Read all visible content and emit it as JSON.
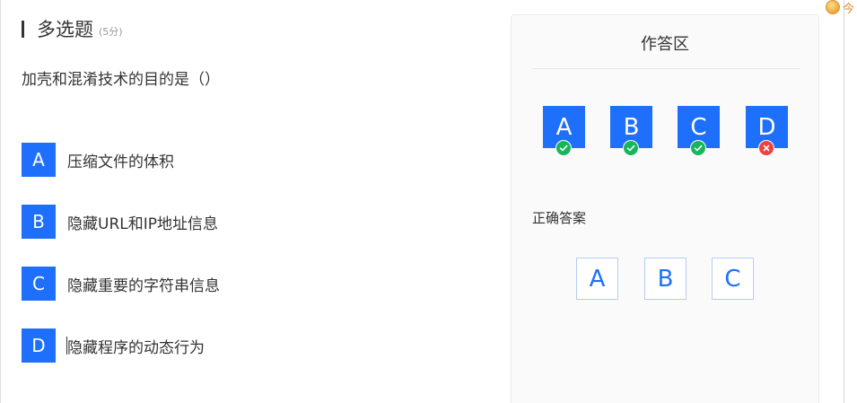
{
  "question": {
    "type_label": "多选题",
    "score": "(5分)",
    "stem": "加壳和混淆技术的目的是（）",
    "options": [
      {
        "letter": "A",
        "text": "压缩文件的体积"
      },
      {
        "letter": "B",
        "text": "隐藏URL和IP地址信息"
      },
      {
        "letter": "C",
        "text": "隐藏重要的字符串信息"
      },
      {
        "letter": "D",
        "text": "隐藏程序的动态行为"
      }
    ]
  },
  "answer_panel": {
    "title": "作答区",
    "selected": [
      {
        "letter": "A",
        "status": "correct",
        "icon": "check-circle-icon"
      },
      {
        "letter": "B",
        "status": "correct",
        "icon": "check-circle-icon"
      },
      {
        "letter": "C",
        "status": "correct",
        "icon": "check-circle-icon"
      },
      {
        "letter": "D",
        "status": "wrong",
        "icon": "x-circle-icon"
      }
    ],
    "correct_label": "正确答案",
    "correct_answers": [
      "A",
      "B",
      "C"
    ]
  },
  "corner_widget": {
    "icon": "coin-icon",
    "text": "今"
  },
  "colors": {
    "accent": "#1e6ffb",
    "correct": "#17b65c",
    "wrong": "#f0413e",
    "corner_text": "#e08a2c"
  }
}
